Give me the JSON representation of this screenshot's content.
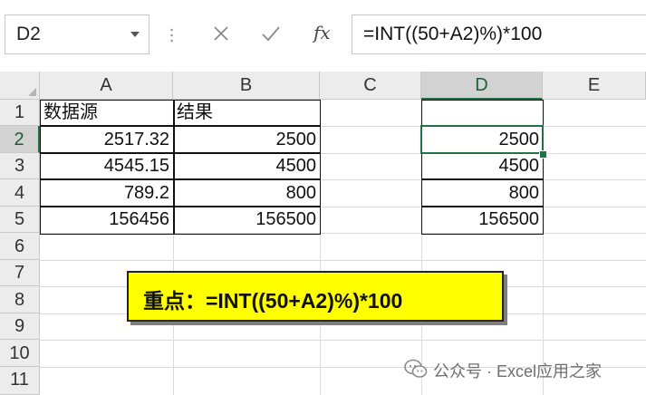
{
  "formula_bar": {
    "name_box": "D2",
    "cancel_icon": "close-icon",
    "enter_icon": "check-icon",
    "fx_label": "fx",
    "formula": "=INT((50+A2)%)*100"
  },
  "sheet": {
    "columns": [
      "A",
      "B",
      "C",
      "D",
      "E"
    ],
    "rows": [
      "1",
      "2",
      "3",
      "4",
      "5",
      "6",
      "7",
      "8",
      "9",
      "10",
      "11"
    ],
    "active_cell": "D2",
    "cells": {
      "A1": "数据源",
      "B1": "结果",
      "A2": "2517.32",
      "B2": "2500",
      "A3": "4545.15",
      "B3": "4500",
      "A4": "789.2",
      "B4": "800",
      "A5": "156456",
      "B5": "156500",
      "D2": "2500",
      "D3": "4500",
      "D4": "800",
      "D5": "156500"
    }
  },
  "callout": {
    "text": "重点：=INT((50+A2)%)*100",
    "color": "#ffff00"
  },
  "watermark": {
    "text": "公众号 · Excel应用之家"
  },
  "colors": {
    "accent": "#217346",
    "header_bg": "#ececec"
  }
}
